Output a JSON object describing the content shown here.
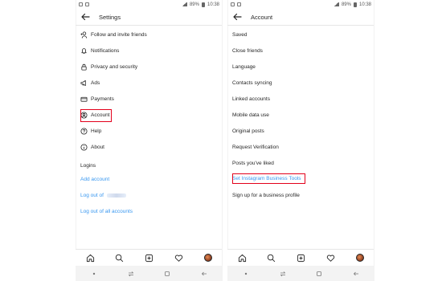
{
  "colors": {
    "link": "#3897f0",
    "highlight": "#e3001b",
    "text": "#262626"
  },
  "status_bar": {
    "time": "10:38",
    "battery": "89%"
  },
  "left_screen": {
    "title": "Settings",
    "items": [
      {
        "label": "Follow and invite friends",
        "icon": "add-person-icon"
      },
      {
        "label": "Notifications",
        "icon": "bell-icon"
      },
      {
        "label": "Privacy and security",
        "icon": "lock-icon"
      },
      {
        "label": "Ads",
        "icon": "megaphone-icon"
      },
      {
        "label": "Payments",
        "icon": "card-icon"
      },
      {
        "label": "Account",
        "icon": "account-circle-icon"
      },
      {
        "label": "Help",
        "icon": "help-icon"
      },
      {
        "label": "About",
        "icon": "info-icon"
      }
    ],
    "logins_label": "Logins",
    "add_account": "Add account",
    "log_out_prefix": "Log out of",
    "log_out_all": "Log out of all accounts"
  },
  "right_screen": {
    "title": "Account",
    "items": [
      "Saved",
      "Close friends",
      "Language",
      "Contacts syncing",
      "Linked accounts",
      "Mobile data use",
      "Original posts",
      "Request Verification",
      "Posts you've liked",
      "Set Instagram Business Tools",
      "Sign up for a business profile"
    ]
  },
  "tab_bar": [
    "home-icon",
    "search-icon",
    "new-post-icon",
    "heart-icon",
    "profile-avatar"
  ],
  "nav_bar": [
    "dot-icon",
    "recents-icon",
    "home-square-icon",
    "back-arrow-icon"
  ]
}
